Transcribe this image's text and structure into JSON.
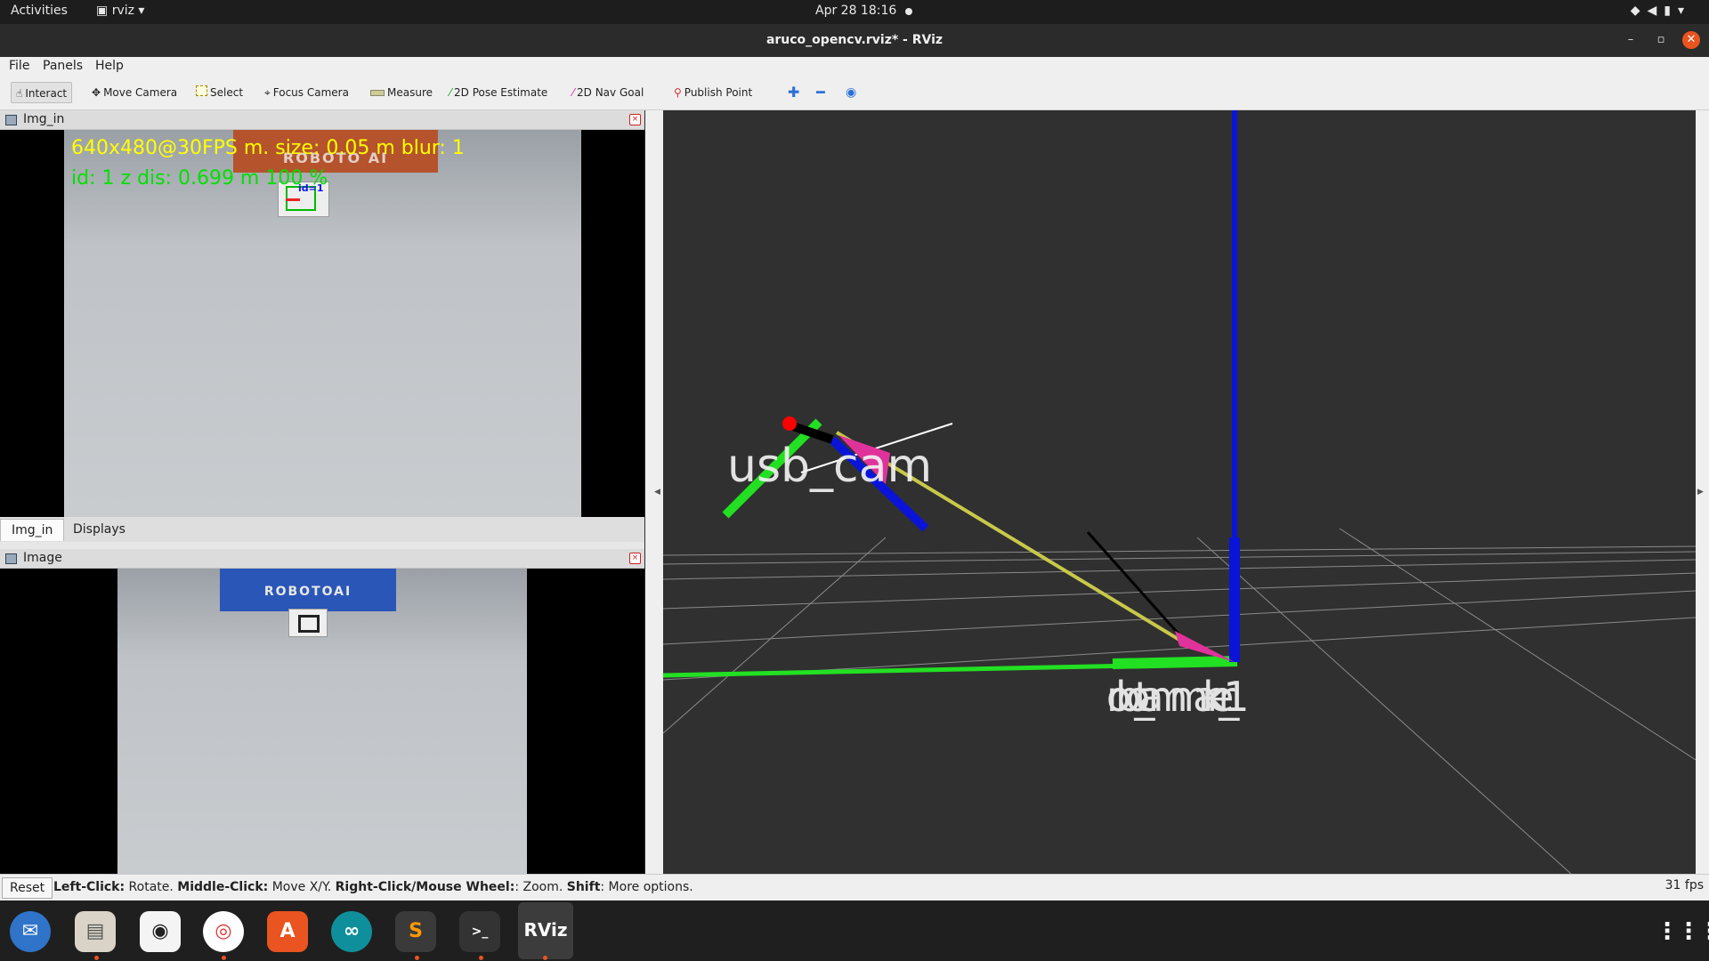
{
  "topbar": {
    "activities": "Activities",
    "app_menu": "rviz",
    "clock": "Apr 28  18:16"
  },
  "window": {
    "title": "aruco_opencv.rviz* - RViz"
  },
  "menu": [
    "File",
    "Panels",
    "Help"
  ],
  "toolbar": {
    "interact": "Interact",
    "move_camera": "Move Camera",
    "select": "Select",
    "focus_camera": "Focus Camera",
    "measure": "Measure",
    "pose_estimate": "2D Pose Estimate",
    "nav_goal": "2D Nav Goal",
    "publish_point": "Publish Point"
  },
  "panels": {
    "img_in": {
      "title": "Img_in",
      "overlay_line1": "640x480@30FPS m. size: 0.05 m blur: 1",
      "overlay_line2": "id: 1 z dis: 0.699 m   100 %",
      "marker_label": "id=1",
      "box_text": "ROBOTO AI"
    },
    "tabs": [
      "Img_in",
      "Displays"
    ],
    "image": {
      "title": "Image",
      "box_text": "ROBOTOAI"
    }
  },
  "view3d": {
    "frame_usb": "usb_cam",
    "frame_markers": "robot_arm marker_1",
    "colors": {
      "x_axis": "#22e022",
      "z_axis": "#0a14d8",
      "link": "#c8c84a",
      "arrow": "#e0329b",
      "grid": "#8a8a8a"
    }
  },
  "status": {
    "reset": "Reset",
    "hint_b1": "Left-Click:",
    "hint_t1": " Rotate. ",
    "hint_b2": "Middle-Click:",
    "hint_t2": " Move X/Y. ",
    "hint_b3": "Right-Click/Mouse Wheel:",
    "hint_t3": ": Zoom. ",
    "hint_b4": "Shift",
    "hint_t4": ": More options.",
    "fps": "31 fps"
  },
  "dock": {
    "rviz_label": "RViz"
  }
}
